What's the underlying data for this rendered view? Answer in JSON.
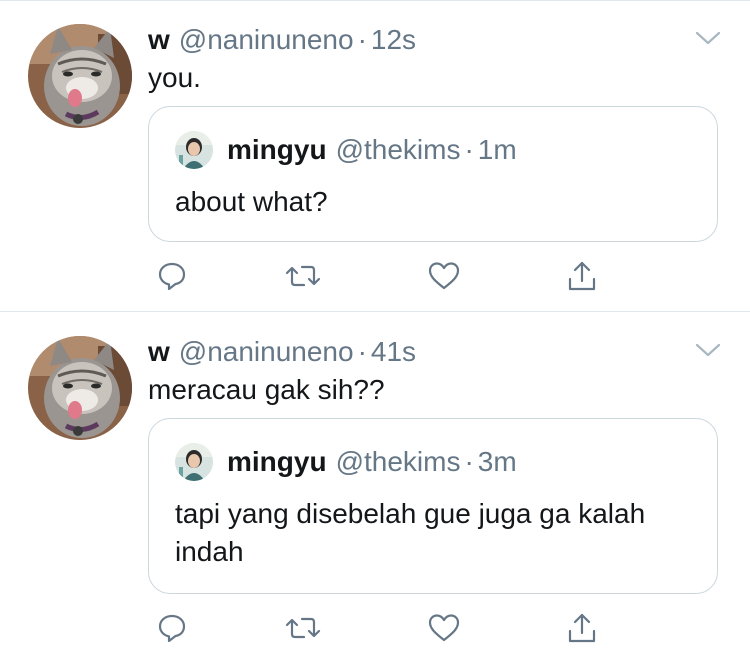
{
  "tweets": [
    {
      "author": {
        "name": "w",
        "handle": "@naninuneno",
        "separator": "·",
        "time": "12s"
      },
      "avatar_icon": "cat-avatar",
      "text": "you.",
      "quoted": {
        "author": {
          "name": "mingyu",
          "handle": "@thekims",
          "separator": "·",
          "time": "1m"
        },
        "avatar_icon": "person-avatar",
        "text": "about what?"
      },
      "actions": [
        "reply-icon",
        "retweet-icon",
        "like-icon",
        "share-icon"
      ]
    },
    {
      "author": {
        "name": "w",
        "handle": "@naninuneno",
        "separator": "·",
        "time": "41s"
      },
      "avatar_icon": "cat-avatar",
      "text": "meracau gak sih??",
      "quoted": {
        "author": {
          "name": "mingyu",
          "handle": "@thekims",
          "separator": "·",
          "time": "3m"
        },
        "avatar_icon": "person-avatar",
        "text": "tapi yang disebelah gue juga ga kalah indah"
      },
      "actions": [
        "reply-icon",
        "retweet-icon",
        "like-icon",
        "share-icon"
      ]
    }
  ],
  "colors": {
    "text": "#14171a",
    "secondary": "#657786",
    "border": "#ccd6dd",
    "divider": "#e1e8ed",
    "icon": "#657786"
  }
}
